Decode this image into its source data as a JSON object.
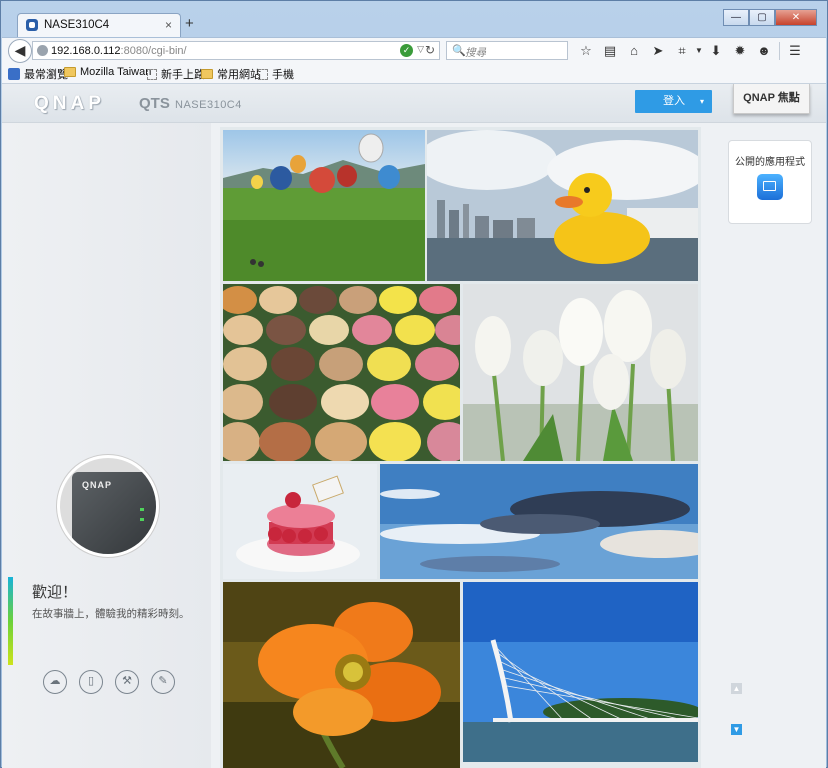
{
  "browser": {
    "tab_title": "NASE310C4",
    "tab_close": "×",
    "new_tab": "+",
    "window_buttons": [
      "—",
      "▢",
      "✕"
    ],
    "back": "◀",
    "url_host": "192.168.0.112",
    "url_rest": ":8080/cgi-bin/",
    "search_placeholder": "搜尋",
    "toolbar_icons": [
      "star-icon",
      "reading-list-icon",
      "home-icon",
      "send-icon",
      "screenshot-icon",
      "dropdown-icon",
      "download-icon",
      "settings-icon",
      "smile-icon",
      "menu-icon"
    ],
    "bookmarks": [
      "最常瀏覽",
      "Mozilla Taiwan",
      "新手上路",
      "常用網站",
      "手機"
    ]
  },
  "qts": {
    "logo": "QNAP",
    "product": "QTS",
    "model": "NASE310C4",
    "login_label": "登入",
    "focus_label": "QNAP 焦點",
    "welcome_title": "歡迎！",
    "welcome_sub": "在故事牆上，體驗我的精彩時刻。",
    "public_apps_label": "公開的應用程式"
  },
  "gallery": {
    "photos": [
      "hot-air-balloons",
      "rubber-duck-harbor",
      "macarons",
      "white-tulips",
      "raspberry-macaron-dessert",
      "blue-sky-clouds",
      "orange-poppy",
      "cable-stayed-bridge"
    ]
  },
  "colors": {
    "accent_blue": "#2f9be5",
    "welcome_bar_top": "#18b3d8",
    "welcome_bar_bottom": "#cde31c"
  }
}
